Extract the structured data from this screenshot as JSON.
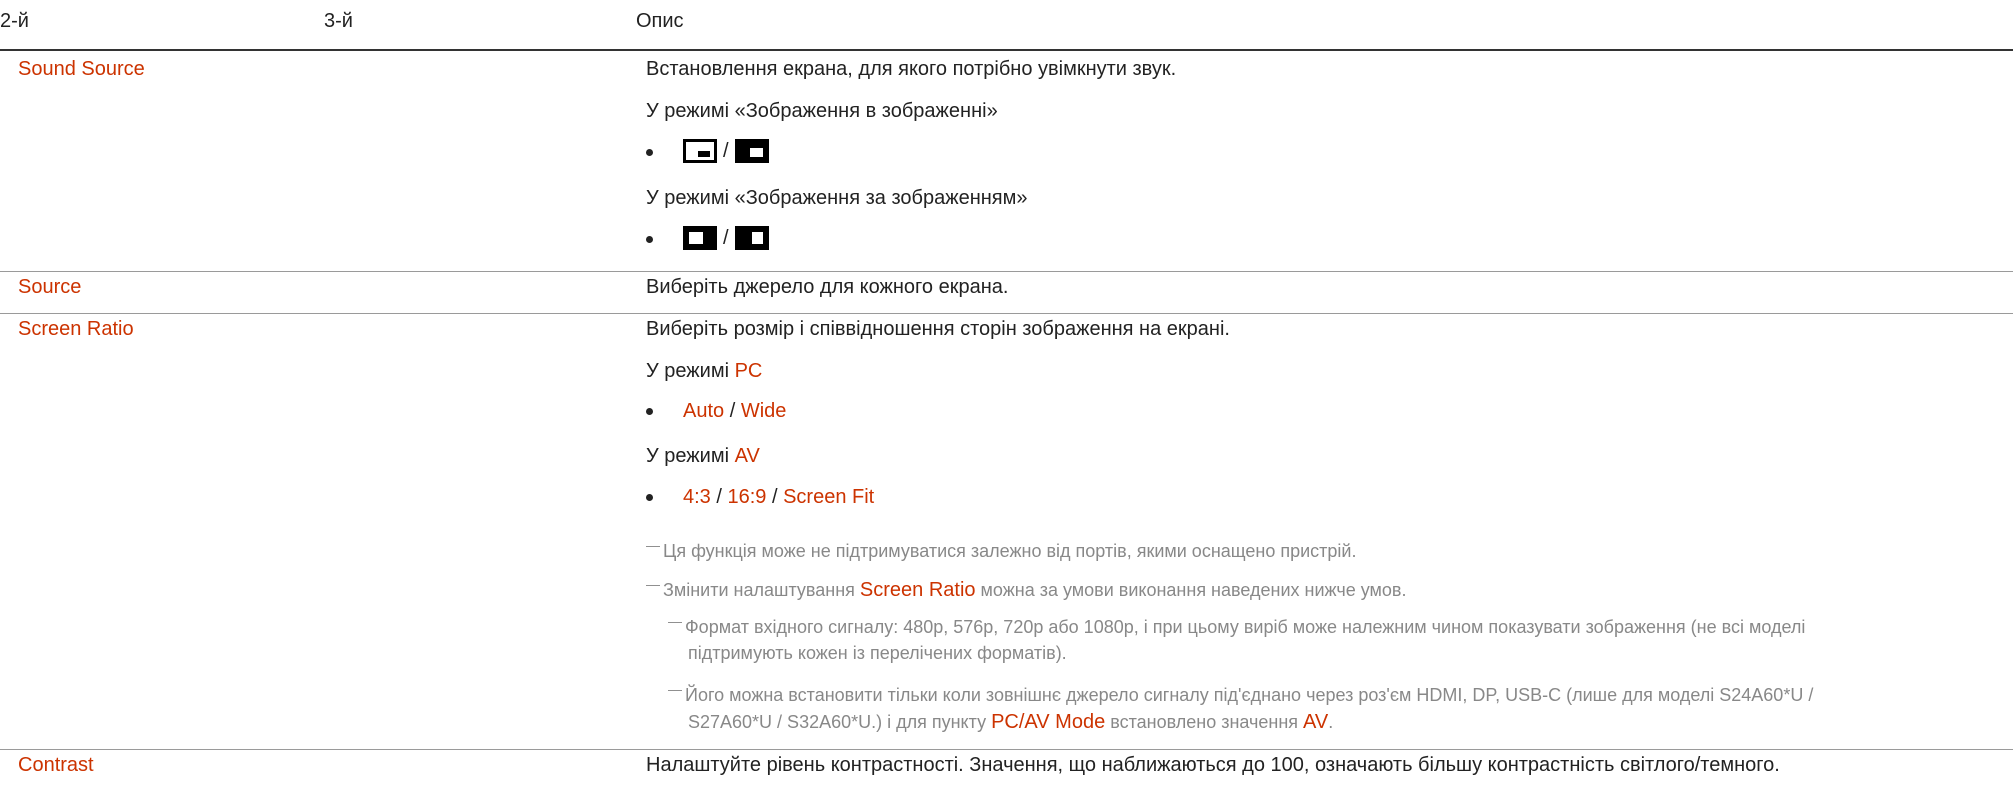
{
  "header": {
    "col1": "2-й",
    "col2": "3-й",
    "col3": "Опис"
  },
  "rows": {
    "sound_source": {
      "name": "Sound Source",
      "desc": "Встановлення екрана, для якого потрібно увімкнути звук.",
      "pip_mode": "У режимі «Зображення в зображенні»",
      "pbp_mode": "У режимі «Зображення за зображенням»",
      "slash": "/"
    },
    "source": {
      "name": "Source",
      "desc": "Виберіть джерело для кожного екрана."
    },
    "screen_ratio": {
      "name": "Screen Ratio",
      "desc": "Виберіть розмір і співвідношення сторін зображення на екрані.",
      "pc_prefix": "У режимі ",
      "pc_mode": "PC",
      "pc_opt1": "Auto",
      "pc_opt2": "Wide",
      "av_prefix": "У режимі ",
      "av_mode": "AV",
      "av_opt1": "4:3",
      "av_opt2": "16:9",
      "av_opt3": "Screen Fit",
      "sep": " / ",
      "note1": "Ця функція може не підтримуватися залежно від портів, якими оснащено пристрій.",
      "note2_pre": "Змінити налаштування ",
      "note2_hl": "Screen Ratio",
      "note2_post": " можна за умови виконання наведених нижче умов.",
      "sub1_line1": "Формат вхідного сигналу: 480p, 576p, 720p або 1080p, і при цьому виріб може належним чином показувати зображення (не всі моделі",
      "sub1_line2": "підтримують кожен із перелічених форматів).",
      "sub2_line1": "Його можна встановити тільки коли зовнішнє джерело сигналу під'єднано через роз'єм HDMI, DP, USB-C (лише для моделі S24A60*U /",
      "sub2_line2_pre": "S27A60*U / S32A60*U.) і для пункту ",
      "sub2_hl1": "PC/AV Mode",
      "sub2_mid": " встановлено значення ",
      "sub2_hl2": "AV",
      "sub2_end": "."
    },
    "contrast": {
      "name": "Contrast",
      "desc": "Налаштуйте рівень контрастності. Значення, що наближаються до 100, означають більшу контрастність світлого/темного."
    }
  },
  "icons": [
    "pip-small-window-icon",
    "pip-large-window-icon",
    "pbp-left-main-icon",
    "pbp-right-main-icon"
  ],
  "colors": {
    "accent": "#cc3300",
    "note": "#888888",
    "text": "#222222"
  }
}
